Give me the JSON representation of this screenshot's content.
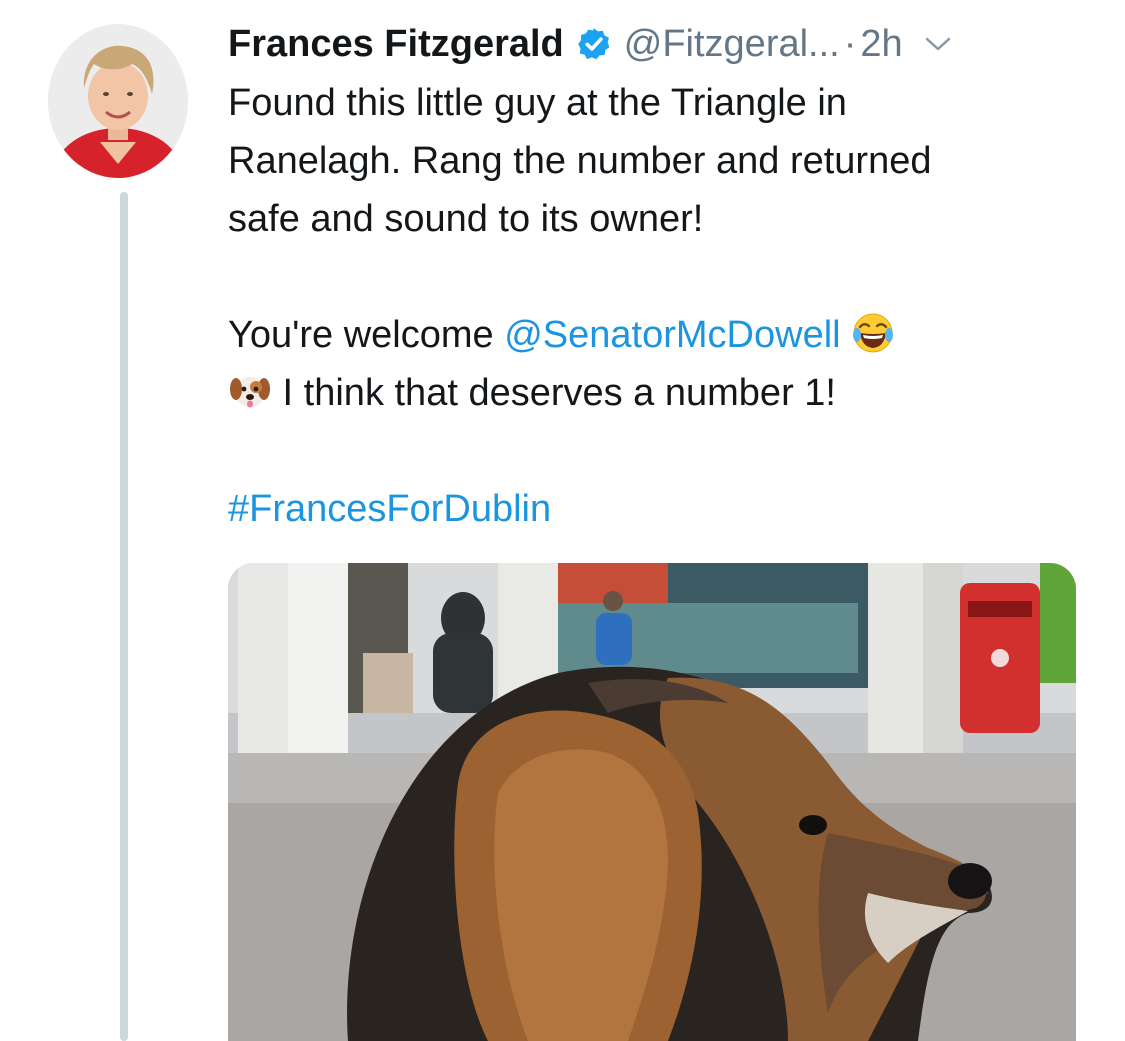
{
  "tweet": {
    "author_name": "Frances Fitzgerald",
    "handle": "@Fitzgeral...",
    "separator": "·",
    "time": "2h",
    "line1": "Found this little guy at the Triangle in",
    "line2": "Ranelagh. Rang the number and returned",
    "line3": "safe and sound to its owner!",
    "line4_prefix": "You're welcome ",
    "mention": "@SenatorMcDowell",
    "line5": " I think that deserves a number 1!",
    "hashtag": "#FrancesForDublin"
  },
  "icons": {
    "verified": "verified-badge-icon",
    "caret": "chevron-down-icon",
    "emoji_laugh": "face-with-tears-of-joy-emoji",
    "emoji_dog": "dog-face-emoji"
  },
  "colors": {
    "link": "#1b95e0",
    "secondary_text": "#657786",
    "thread_line": "#ccd6dd",
    "verified": "#1da1f2"
  }
}
